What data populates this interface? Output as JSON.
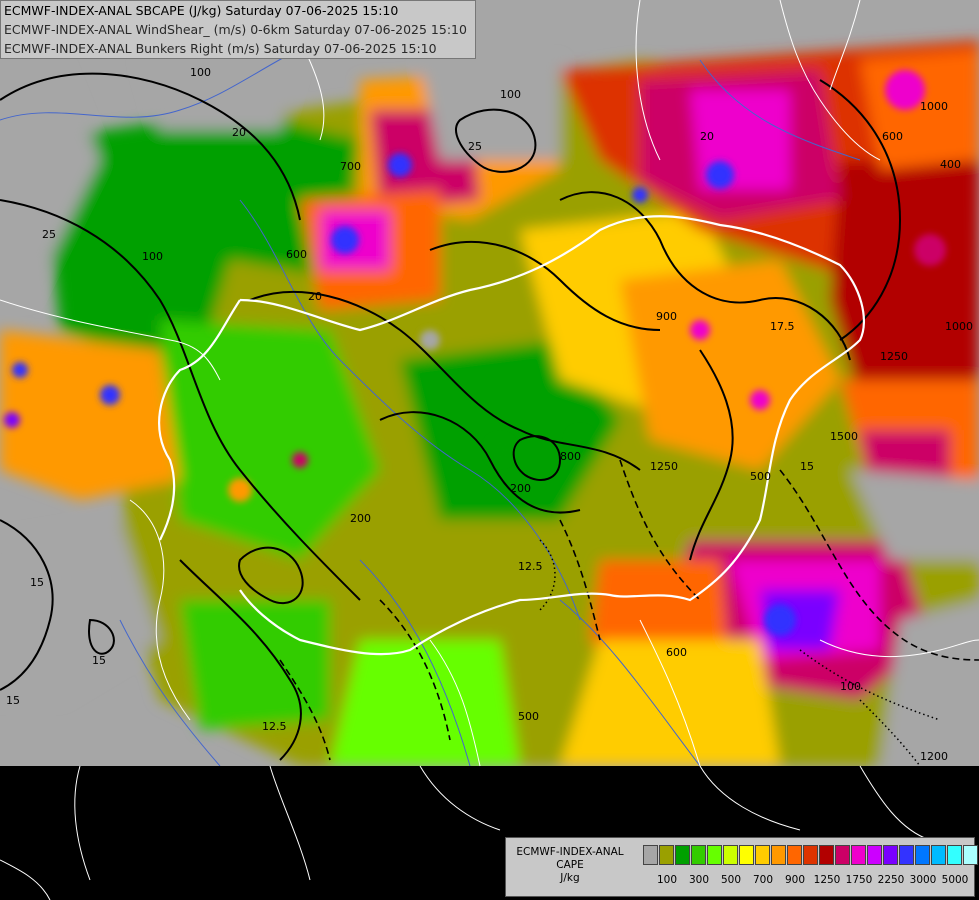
{
  "header": {
    "line1": "ECMWF-INDEX-ANAL SBCAPE (J/kg) Saturday 07-06-2025 15:10",
    "line2": "ECMWF-INDEX-ANAL WindShear_ (m/s) 0-6km Saturday 07-06-2025 15:10",
    "line3": "ECMWF-INDEX-ANAL Bunkers Right (m/s) Saturday 07-06-2025 15:10"
  },
  "legend": {
    "title1": "ECMWF-INDEX-ANAL",
    "title2": "CAPE",
    "unit": "J/kg",
    "tick_labels": [
      "100",
      "300",
      "500",
      "700",
      "900",
      "1250",
      "1750",
      "2250",
      "3000",
      "5000"
    ],
    "colors": [
      "#a6a6a6",
      "#9aa000",
      "#00a000",
      "#33cc00",
      "#66ff00",
      "#ccff00",
      "#ffff00",
      "#ffcc00",
      "#ff9900",
      "#ff6600",
      "#dd3300",
      "#b20000",
      "#cc0066",
      "#ee00cc",
      "#cc00ff",
      "#7a00ff",
      "#3333ff",
      "#0077ff",
      "#00bbff",
      "#33ffff",
      "#aaffff",
      "#ffffff"
    ]
  },
  "map_labels": [
    "100",
    "20",
    "25",
    "700",
    "100",
    "1000",
    "600",
    "25",
    "100",
    "20",
    "600",
    "400",
    "200",
    "17.5",
    "15",
    "1250",
    "800",
    "15",
    "12.5",
    "200",
    "500",
    "900",
    "1500",
    "100",
    "600",
    "1250",
    "12.5",
    "15",
    "500",
    "1000",
    "1200",
    "20",
    "15"
  ],
  "colors": {
    "background": "#000000",
    "no_data": "#a6a6a6",
    "border": "#ffffff",
    "river": "#4466cc",
    "contour": "#000000"
  }
}
